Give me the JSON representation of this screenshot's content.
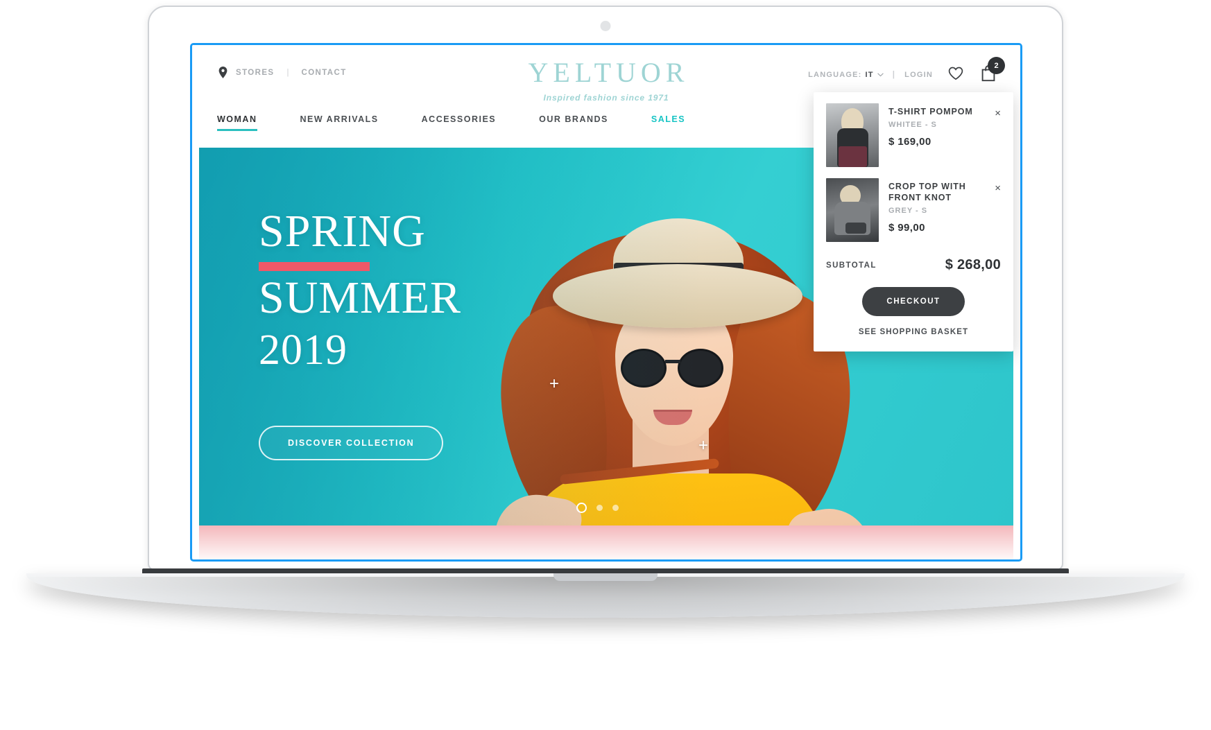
{
  "header": {
    "stores_label": "STORES",
    "separator": "|",
    "contact_label": "CONTACT",
    "language_label": "LANGUAGE:",
    "language_value": "IT",
    "login_label": "LOGIN",
    "cart_count": "2"
  },
  "brand": {
    "name": "YELTUOR",
    "tagline": "Inspired fashion since 1971",
    "color": "#9ed4d4"
  },
  "nav": {
    "items": [
      {
        "label": "WOMAN"
      },
      {
        "label": "NEW ARRIVALS"
      },
      {
        "label": "ACCESSORIES"
      },
      {
        "label": "OUR BRANDS"
      },
      {
        "label": "SALES"
      }
    ]
  },
  "hero": {
    "line1": "SPRING",
    "line2": "SUMMER",
    "line3": "2019",
    "cta_label": "DISCOVER COLLECTION",
    "rule_color": "#ef5868",
    "hotspot_glyph": "+"
  },
  "cart": {
    "items": [
      {
        "title": "T-SHIRT POMPOM",
        "variant": "WHITEE - S",
        "price": "$ 169,00",
        "remove_glyph": "×"
      },
      {
        "title": "CROP TOP WITH FRONT KNOT",
        "variant": "GREY - S",
        "price": "$ 99,00",
        "remove_glyph": "×"
      }
    ],
    "subtotal_label": "SUBTOTAL",
    "subtotal_value": "$ 268,00",
    "checkout_label": "CHECKOUT",
    "see_basket_label": "SEE SHOPPING BASKET"
  }
}
